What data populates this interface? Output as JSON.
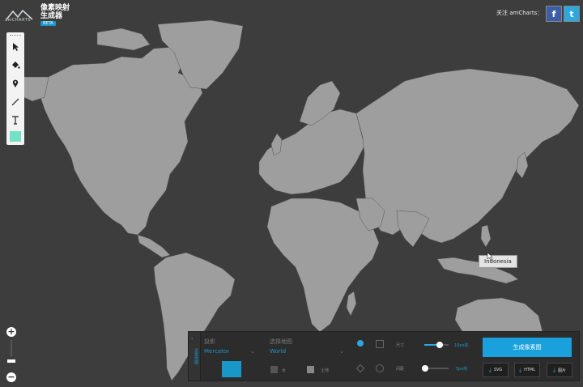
{
  "header": {
    "brand": "amCHARTS",
    "app_title_line1": "像素映射",
    "app_title_line2": "生成器",
    "beta": "BETA",
    "follow_label": "关注 amCharts：",
    "facebook_icon": "f",
    "twitter_icon": "t"
  },
  "toolbox": {
    "tools": [
      "arrow-icon",
      "fill-icon",
      "pin-icon",
      "line-icon",
      "text-icon"
    ],
    "color": "#73e1c3"
  },
  "map": {
    "land_color": "#9e9e9e",
    "background": "#3d3d3d",
    "tooltip": "Indonesia"
  },
  "zoom": {
    "plus": "+",
    "minus": "−"
  },
  "panel": {
    "tab_label": "设置地图",
    "projection_label": "投影",
    "projection_value": "Mercator",
    "map_label": "选择地图",
    "map_value": "World",
    "water_label": "水",
    "land_label": "土地",
    "size_label": "尺寸",
    "size_value": "10px的",
    "spacing_label": "间距",
    "spacing_value": "5px的",
    "generate_label": "生成像素图",
    "svg_label": "SVG",
    "html_label": "HTML",
    "image_label": "图片",
    "accent": "#1a97c9"
  }
}
